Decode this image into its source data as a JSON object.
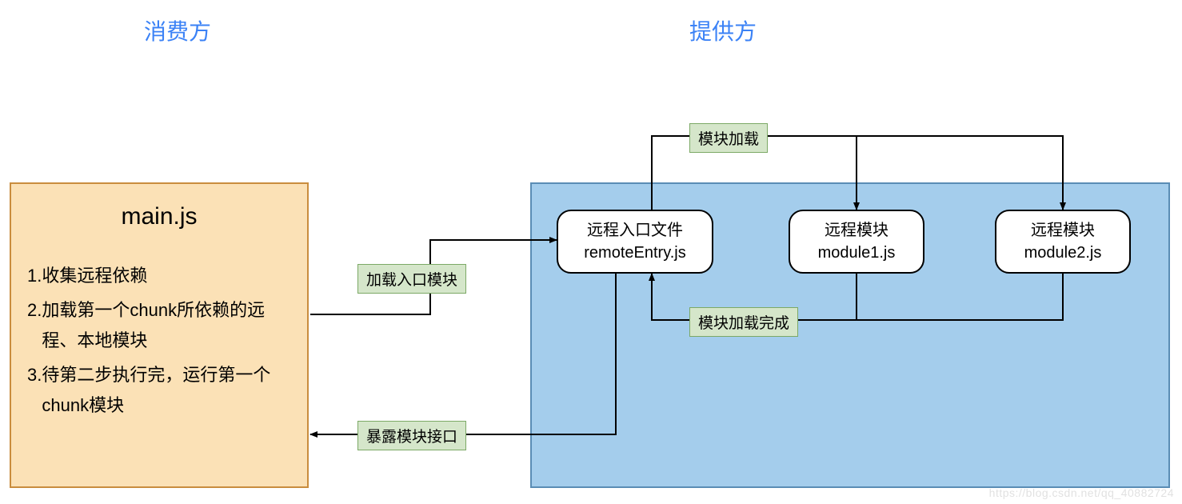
{
  "headers": {
    "consumer": "消费方",
    "provider": "提供方"
  },
  "consumer": {
    "title": "main.js",
    "items": [
      {
        "num": "1. ",
        "text": "收集远程依赖"
      },
      {
        "num": "2. ",
        "text": "加载第一个chunk所依赖的远程、本地模块"
      },
      {
        "num": "3. ",
        "text": "待第二步执行完，运行第一个chunk模块"
      }
    ]
  },
  "provider": {
    "remote_entry": {
      "line1": "远程入口文件",
      "line2": "remoteEntry.js"
    },
    "module1": {
      "line1": "远程模块",
      "line2": "module1.js"
    },
    "module2": {
      "line1": "远程模块",
      "line2": "module2.js"
    }
  },
  "labels": {
    "load_entry": "加载入口模块",
    "expose_interface": "暴露模块接口",
    "module_load": "模块加载",
    "module_load_done": "模块加载完成"
  },
  "watermark": "https://blog.csdn.net/qq_40882724"
}
